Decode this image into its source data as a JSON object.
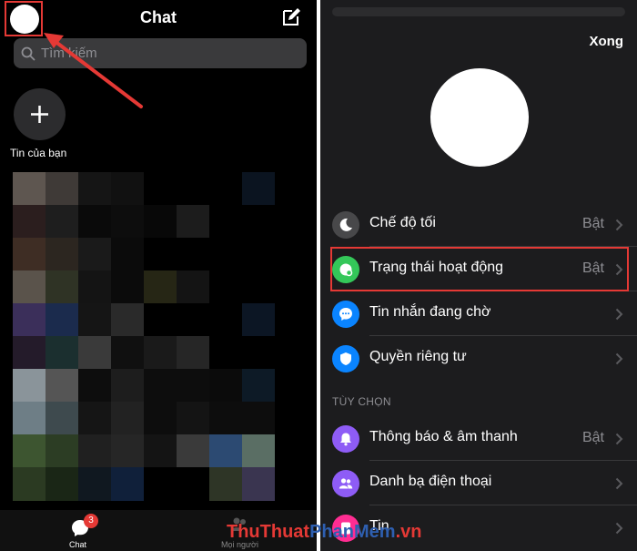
{
  "left": {
    "title": "Chat",
    "search_placeholder": "Tìm kiếm",
    "story_label": "Tin của bạn",
    "tabs": [
      {
        "label": "Chat",
        "badge": "3",
        "icon": "chat-bubble-icon"
      },
      {
        "label": "Mọi người",
        "icon": "people-icon"
      }
    ]
  },
  "right": {
    "done_label": "Xong",
    "rows": [
      {
        "label": "Chế độ tối",
        "value": "Bật",
        "icon": "moon-icon",
        "color": "#48484a"
      },
      {
        "label": "Trạng thái hoạt động",
        "value": "Bật",
        "icon": "active-status-icon",
        "color": "#34c759"
      },
      {
        "label": "Tin nhắn đang chờ",
        "value": "",
        "icon": "message-pending-icon",
        "color": "#0a84ff"
      },
      {
        "label": "Quyền riêng tư",
        "value": "",
        "icon": "shield-icon",
        "color": "#0a84ff"
      }
    ],
    "section_title": "TÙY CHỌN",
    "option_rows": [
      {
        "label": "Thông báo & âm thanh",
        "value": "Bật",
        "icon": "bell-icon",
        "color": "#8e5cf6"
      },
      {
        "label": "Danh bạ điện thoại",
        "value": "",
        "icon": "contacts-icon",
        "color": "#8e5cf6"
      },
      {
        "label": "Tin",
        "value": "",
        "icon": "story-icon",
        "color": "#ff2d92"
      }
    ]
  },
  "watermark": {
    "part1": "ThuThuat",
    "part2": "PhanMem",
    "part3": ".vn"
  },
  "colors": {
    "highlight": "#e53935",
    "background": "#000000",
    "sheet": "#1c1c1e"
  }
}
